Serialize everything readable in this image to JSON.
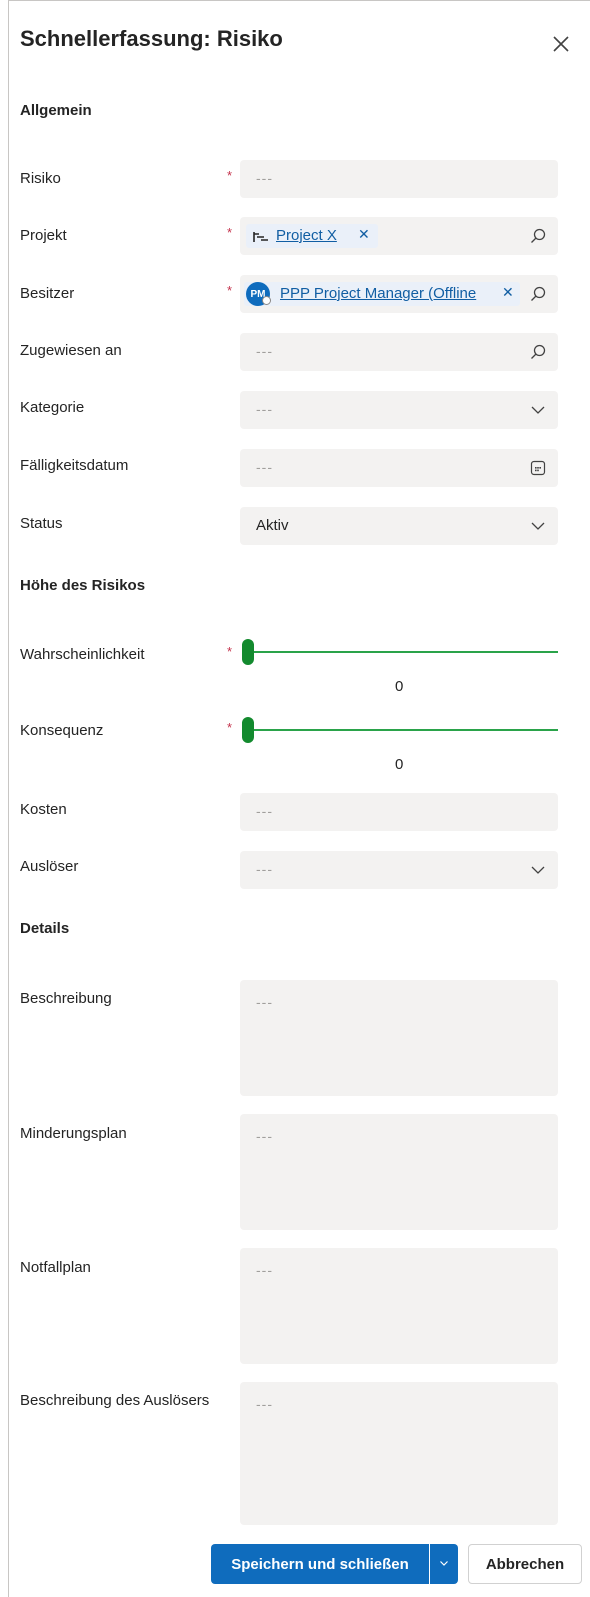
{
  "dialog": {
    "title": "Schnellerfassung: Risiko",
    "close_icon": "close-icon"
  },
  "sections": {
    "general": "Allgemein",
    "risk_level": "Höhe des Risikos",
    "details": "Details"
  },
  "placeholder": "---",
  "required_mark": "*",
  "fields": {
    "risk": {
      "label": "Risiko",
      "required": true,
      "value": ""
    },
    "project": {
      "label": "Projekt",
      "required": true,
      "value": "Project X",
      "icon": "project-icon",
      "lookup_icon": "search-icon"
    },
    "owner": {
      "label": "Besitzer",
      "required": true,
      "value": "PPP Project Manager (Offline",
      "avatar_initials": "PM",
      "lookup_icon": "search-icon"
    },
    "assigned_to": {
      "label": "Zugewiesen an",
      "value": "",
      "lookup_icon": "search-icon"
    },
    "category": {
      "label": "Kategorie",
      "value": "",
      "icon": "chevron-down-icon"
    },
    "due_date": {
      "label": "Fälligkeitsdatum",
      "value": "",
      "icon": "calendar-icon"
    },
    "status": {
      "label": "Status",
      "value": "Aktiv",
      "icon": "chevron-down-icon"
    },
    "probability": {
      "label": "Wahrscheinlichkeit",
      "required": true,
      "value": "0"
    },
    "consequence": {
      "label": "Konsequenz",
      "required": true,
      "value": "0"
    },
    "cost": {
      "label": "Kosten",
      "value": ""
    },
    "trigger": {
      "label": "Auslöser",
      "value": "",
      "icon": "chevron-down-icon"
    },
    "description": {
      "label": "Beschreibung",
      "value": ""
    },
    "mitigation_plan": {
      "label": "Minderungsplan",
      "value": ""
    },
    "contingency_plan": {
      "label": "Notfallplan",
      "value": ""
    },
    "trigger_description": {
      "label": "Beschreibung des Auslösers",
      "value": ""
    }
  },
  "footer": {
    "save_close": "Speichern und schließen",
    "cancel": "Abbrechen"
  },
  "colors": {
    "accent": "#0f6cbd",
    "slider": "#138a2e",
    "required": "#c4314b",
    "link": "#115ea3"
  }
}
